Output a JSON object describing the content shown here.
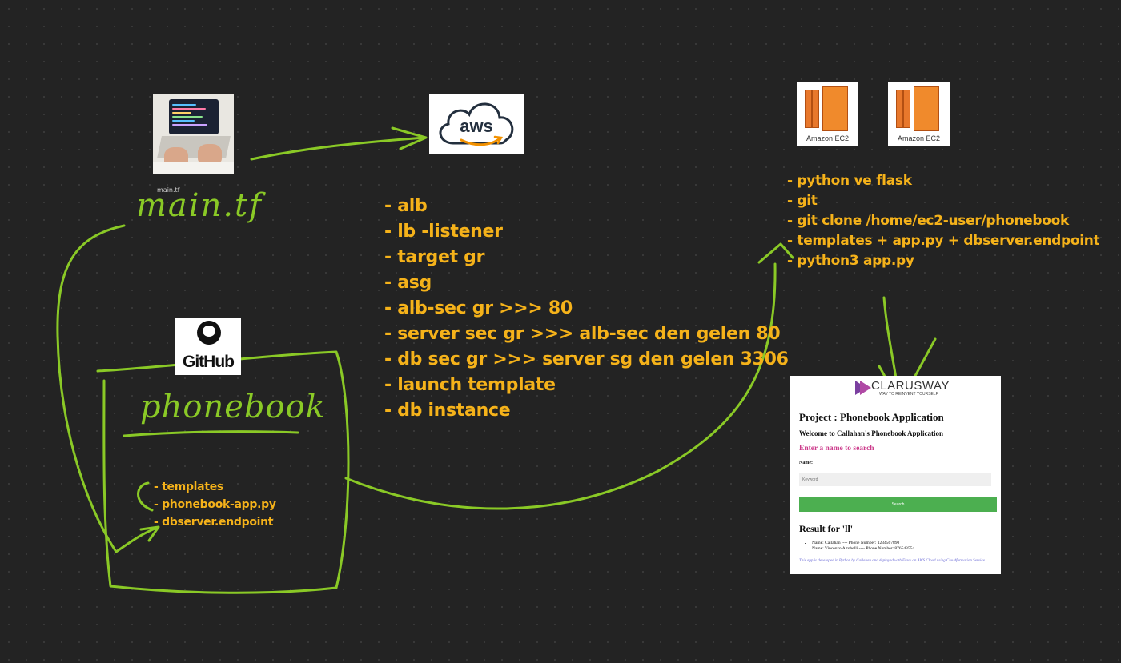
{
  "laptop": {
    "caption": "main.tf"
  },
  "main_label": "main.tf",
  "aws_logo": {
    "text": "aws"
  },
  "github_logo": {
    "text": "GitHub"
  },
  "phonebook_label": "phonebook",
  "aws_resources": [
    "- alb",
    "- lb -listener",
    "- target gr",
    "- asg",
    "- alb-sec gr >>> 80",
    "- server sec gr >>> alb-sec den gelen 80",
    "- db sec gr >>> server sg den gelen 3306",
    "- launch template",
    "- db instance"
  ],
  "ec2_icons": [
    {
      "label": "Amazon EC2"
    },
    {
      "label": "Amazon EC2"
    }
  ],
  "ec2_steps": [
    "- python ve flask",
    "- git",
    "- git clone /home/ec2-user/phonebook",
    "- templates + app.py + dbserver.endpoint",
    "- python3 app.py"
  ],
  "repo_files": [
    "- templates",
    "- phonebook-app.py",
    "- dbserver.endpoint"
  ],
  "app_preview": {
    "brand": "CLARUSWAY",
    "tagline": "WAY TO REINVENT YOURSELF",
    "title": "Project : Phonebook Application",
    "welcome": "Welcome to Callahan's Phonebook Application",
    "enter_prompt": "Enter a name to search",
    "name_label": "Name:",
    "keyword_placeholder": "Keyword",
    "search_button": "Search",
    "result_title": "Result for 'll'",
    "results": [
      "Name: Callahan ---- Phone Number: 1234567890",
      "Name: Vincenzo Altobelli ---- Phone Number: 876543554"
    ],
    "footer": "This app is developed in Python by Callahan and deployed with Flask on AWS Cloud using Cloudformation Service"
  },
  "colors": {
    "background": "#232323",
    "annotation_text": "#f5b21a",
    "stroke_green": "#8ac926",
    "aws_orange": "#f29100",
    "ec2_orange": "#e8782c"
  }
}
